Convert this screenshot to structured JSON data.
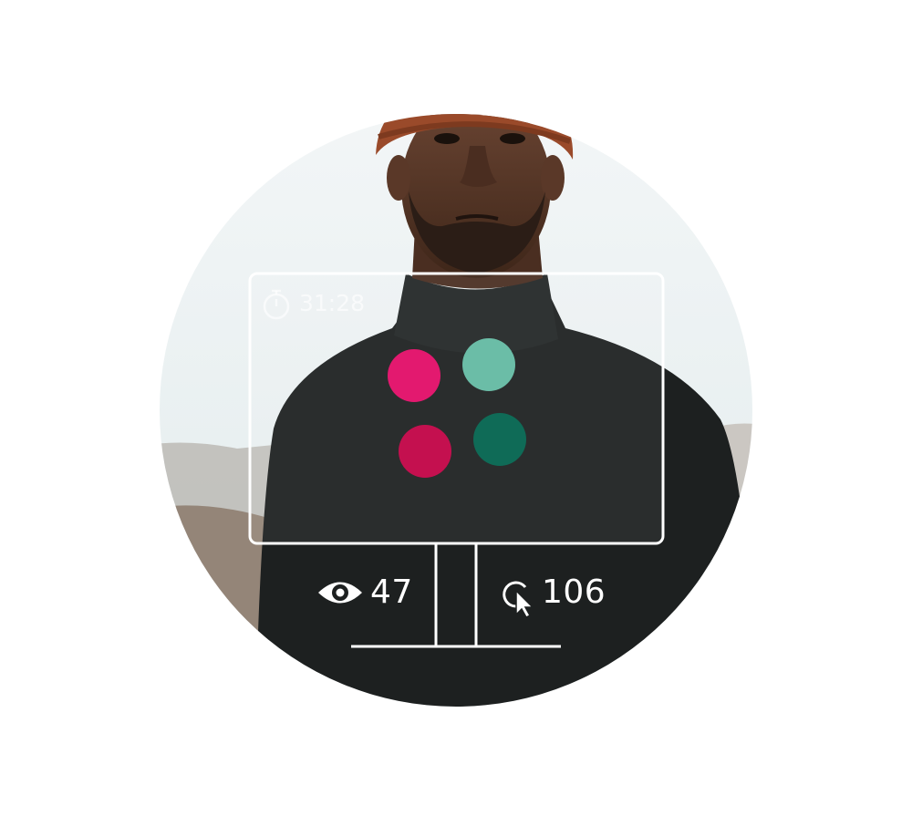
{
  "overlay": {
    "timer": {
      "icon": "stopwatch-icon",
      "value": "31:28"
    },
    "views": {
      "icon": "eye-icon",
      "value": "47"
    },
    "clicks": {
      "icon": "click-cursor-icon",
      "value": "106"
    },
    "color_dots": [
      "#e3196f",
      "#6bbda7",
      "#c4104f",
      "#0f6b57"
    ]
  },
  "colors": {
    "sky": "#eef3f4",
    "sweater": "#1d2020",
    "hat": "#9a4a2a",
    "skin": "#5a3a2a",
    "outline": "#ffffff"
  }
}
